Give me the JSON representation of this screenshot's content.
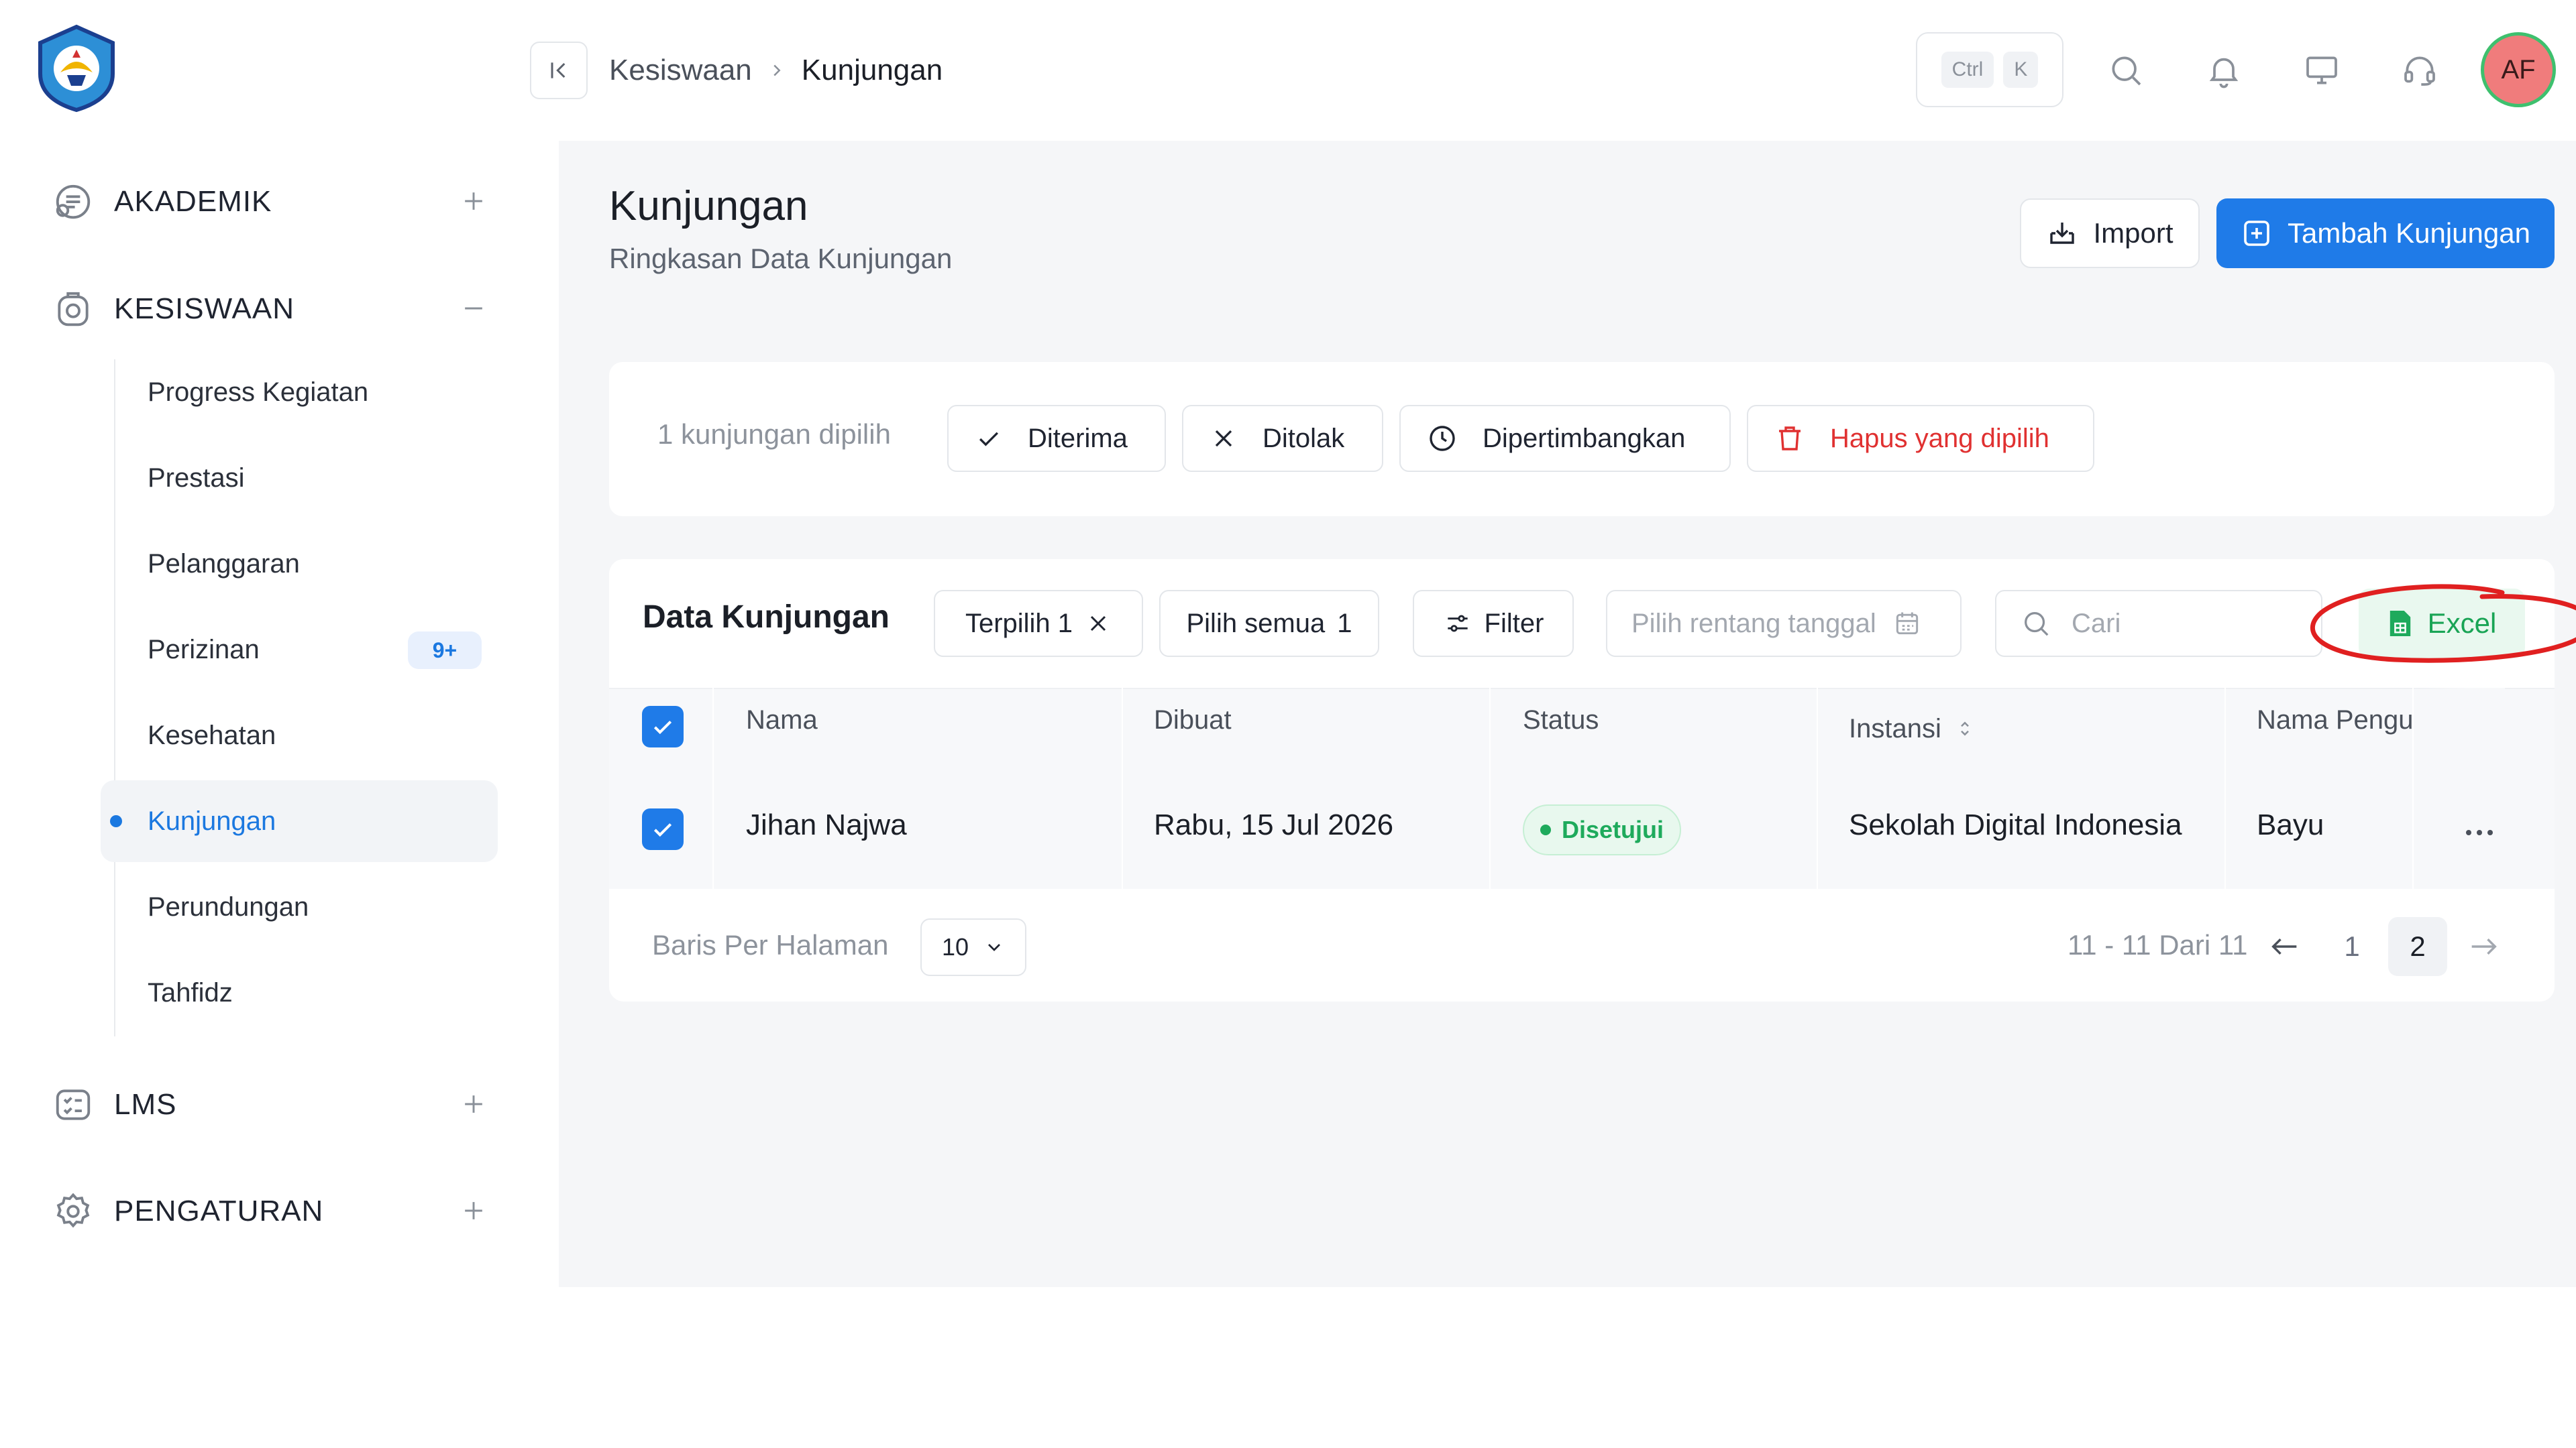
{
  "sidebar": {
    "sections": [
      {
        "label": "AKADEMIK",
        "icon": "academic-icon",
        "expanded": false
      },
      {
        "label": "KESISWAAN",
        "icon": "student-icon",
        "expanded": true
      },
      {
        "label": "LMS",
        "icon": "lms-icon",
        "expanded": false
      },
      {
        "label": "PENGATURAN",
        "icon": "settings-icon",
        "expanded": false
      }
    ],
    "subitems": [
      {
        "label": "Progress Kegiatan"
      },
      {
        "label": "Prestasi"
      },
      {
        "label": "Pelanggaran"
      },
      {
        "label": "Perizinan",
        "badge": "9+"
      },
      {
        "label": "Kesehatan"
      },
      {
        "label": "Kunjungan",
        "active": true
      },
      {
        "label": "Perundungan"
      },
      {
        "label": "Tahfidz"
      }
    ]
  },
  "header": {
    "breadcrumb": [
      "Kesiswaan",
      "Kunjungan"
    ],
    "shortcut": [
      "Ctrl",
      "K"
    ],
    "avatar_initials": "AF"
  },
  "page": {
    "title": "Kunjungan",
    "subtitle": "Ringkasan Data Kunjungan",
    "import_label": "Import",
    "add_label": "Tambah Kunjungan"
  },
  "bulk": {
    "selected_text": "1 kunjungan dipilih",
    "accept": "Diterima",
    "reject": "Ditolak",
    "consider": "Dipertimbangkan",
    "delete": "Hapus yang dipilih"
  },
  "table_card": {
    "title": "Data Kunjungan",
    "chip_selected": "Terpilih 1",
    "chip_select_all_label": "Pilih semua",
    "chip_select_all_count": "1",
    "filter_label": "Filter",
    "date_placeholder": "Pilih rentang tanggal",
    "search_placeholder": "Cari",
    "excel_label": "Excel",
    "columns": [
      "Nama",
      "Dibuat",
      "Status",
      "Instansi",
      "Nama Pengu"
    ],
    "rows": [
      {
        "nama": "Jihan Najwa",
        "dibuat": "Rabu, 15 Jul 2026",
        "status": "Disetujui",
        "instansi": "Sekolah Digital Indonesia",
        "nama_pengunjung": "Bayu"
      }
    ]
  },
  "pagination": {
    "rows_label": "Baris Per Halaman",
    "rows_value": "10",
    "info": "11 - 11 Dari 11",
    "pages": [
      "1",
      "2"
    ],
    "current_page": "2"
  },
  "colors": {
    "accent": "#1f7be8",
    "danger": "#e03131",
    "success": "#1eaa5c",
    "annotation": "#e02020"
  }
}
